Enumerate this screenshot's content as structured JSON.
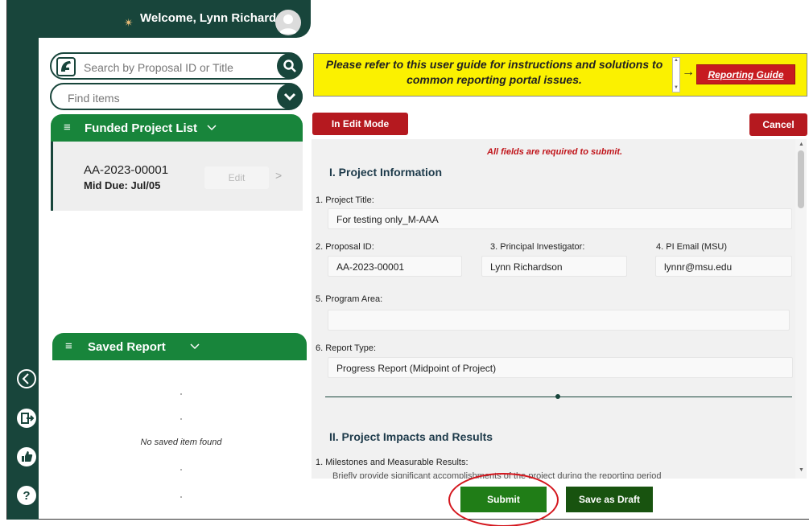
{
  "header": {
    "welcome": "Welcome, Lynn Richardson"
  },
  "search": {
    "placeholder": "Search by Proposal ID or Title"
  },
  "find": {
    "placeholder": "Find items"
  },
  "funded_list": {
    "title": "Funded Project List",
    "items": [
      {
        "id": "AA-2023-00001",
        "due": "Mid Due: Jul/05",
        "edit_label": "Edit"
      }
    ]
  },
  "saved_report": {
    "title": "Saved Report",
    "empty_text": "No saved item found"
  },
  "guide": {
    "text": "Please refer to this user guide for instructions and solutions to common reporting portal issues.",
    "button_label": "Reporting Guide"
  },
  "toolbar": {
    "edit_mode_label": "In Edit Mode",
    "cancel_label": "Cancel"
  },
  "form": {
    "required_note": "All fields are required to submit.",
    "section1_title": "I. Project Information",
    "project_title": {
      "label": "1. Project Title:",
      "value": "For testing only_M-AAA"
    },
    "proposal_id": {
      "label": "2. Proposal ID:",
      "value": "AA-2023-00001"
    },
    "pi": {
      "label": "3. Principal Investigator:",
      "value": "Lynn Richardson"
    },
    "pi_email": {
      "label": "4. PI Email (MSU)",
      "value": "lynnr@msu.edu"
    },
    "program_area": {
      "label": "5. Program Area:",
      "value": ""
    },
    "report_type": {
      "label": "6. Report Type:",
      "value": "Progress Report (Midpoint of Project)"
    },
    "section2_title": "II. Project Impacts and Results",
    "milestones_label": "1. Milestones and Measurable Results:",
    "milestones_hint": "Briefly provide significant accomplishments of the project during the reporting period"
  },
  "actions": {
    "submit_label": "Submit",
    "draft_label": "Save as Draft"
  },
  "colors": {
    "brand_green": "#18453b",
    "accent_green": "#18853b",
    "alert_red": "#b5191f",
    "banner_yellow": "#fbf100"
  }
}
